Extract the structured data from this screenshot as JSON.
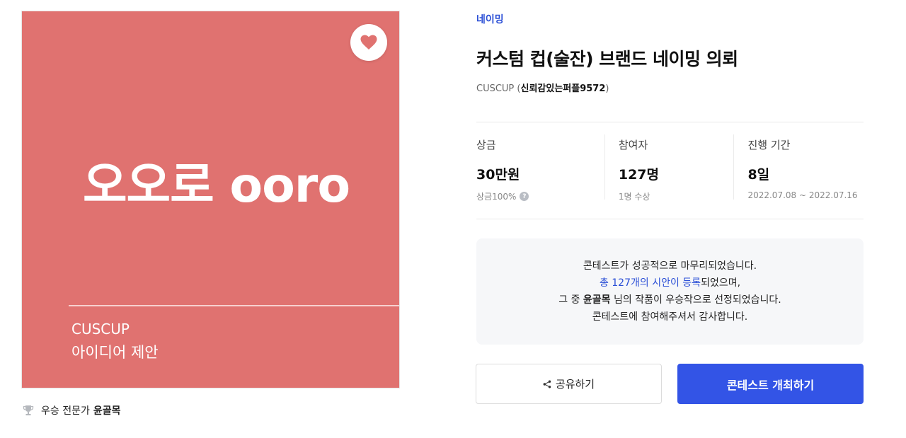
{
  "thumbnail": {
    "headline": "오오로 ooro",
    "brand": "CUSCUP",
    "caption": "아이디어 제안",
    "background_color": "#e07270"
  },
  "favorite_icon": "heart-icon",
  "winner": {
    "label": "우승 전문가",
    "name": "윤골목",
    "icon": "trophy-icon"
  },
  "contest": {
    "category": "네이밍",
    "title": "커스텀 컵(술잔) 브랜드 네이밍 의뢰",
    "company": "CUSCUP",
    "host_open": " (",
    "host": "신뢰감있는퍼플9572",
    "host_close": ")"
  },
  "stats": [
    {
      "label": "상금",
      "value": "30만원",
      "sub": "상금100%",
      "help_icon": "?"
    },
    {
      "label": "참여자",
      "value": "127명",
      "sub": "1명 수상"
    },
    {
      "label": "진행 기간",
      "value": "8일",
      "sub": "2022.07.08 ~ 2022.07.16"
    }
  ],
  "notice": {
    "line1": "콘테스트가 성공적으로 마무리되었습니다.",
    "line2_link": "총 127개의 시안이 등록",
    "line2_rest": "되었으며,",
    "line3_pre": "그 중 ",
    "line3_name": "윤골목",
    "line3_post": " 님의 작품이 우승작으로 선정되었습니다.",
    "line4": "콘테스트에 참여해주셔서 감사합니다."
  },
  "actions": {
    "share_label": "공유하기",
    "host_label": "콘테스트 개최하기"
  },
  "colors": {
    "accent": "#3354e6",
    "link": "#2b4fd6",
    "heart": "#e07270"
  }
}
